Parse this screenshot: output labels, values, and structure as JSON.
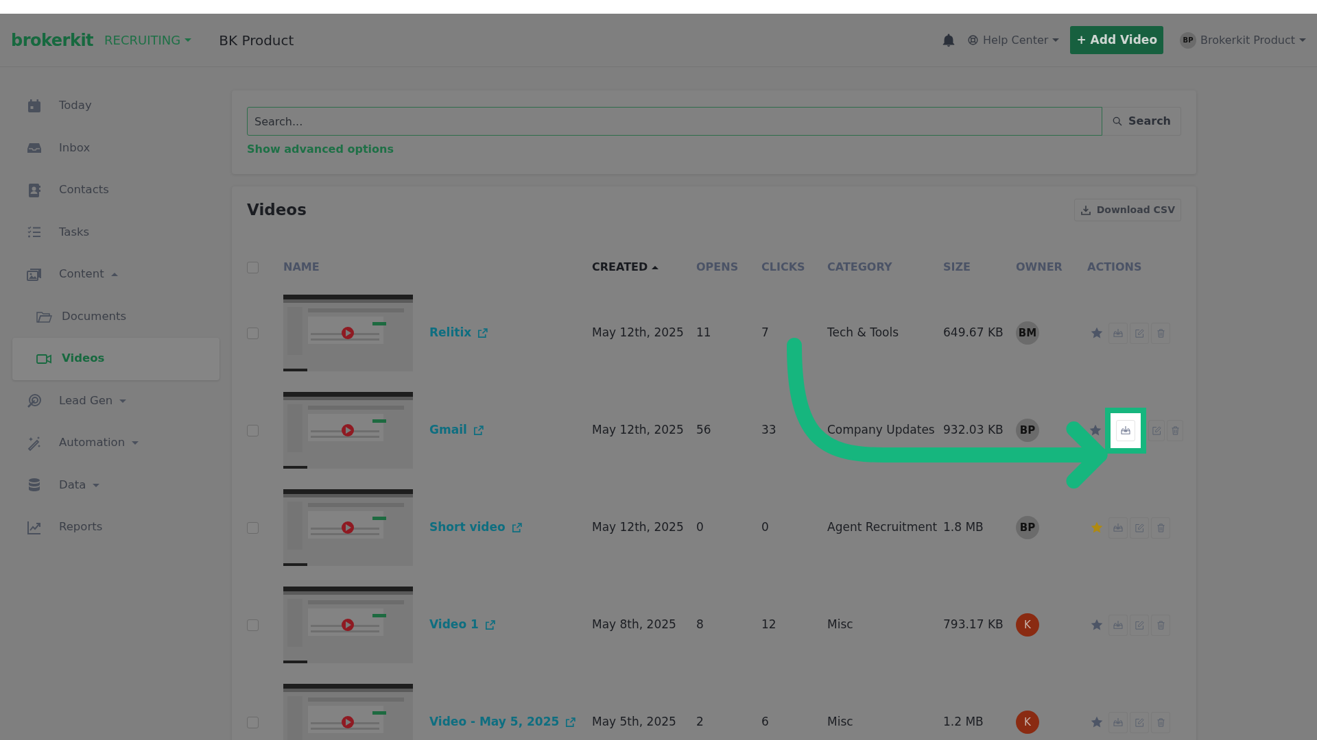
{
  "header": {
    "brand": "brokerkit",
    "module": "RECRUITING",
    "workspace": "BK Product",
    "help": "Help Center",
    "add_button": "+ Add Video",
    "user": {
      "initials": "BP",
      "name": "Brokerkit Product"
    }
  },
  "sidebar": {
    "items": [
      {
        "label": "Today",
        "selected": false
      },
      {
        "label": "Inbox",
        "selected": false
      },
      {
        "label": "Contacts",
        "selected": false
      },
      {
        "label": "Tasks",
        "selected": false
      },
      {
        "label": "Content",
        "selected": false,
        "expanded": true,
        "children": [
          {
            "label": "Documents",
            "selected": false
          },
          {
            "label": "Videos",
            "selected": true
          }
        ]
      },
      {
        "label": "Lead Gen",
        "selected": false,
        "expanded": false
      },
      {
        "label": "Automation",
        "selected": false,
        "expanded": false
      },
      {
        "label": "Data",
        "selected": false,
        "expanded": false
      },
      {
        "label": "Reports",
        "selected": false
      }
    ]
  },
  "search": {
    "placeholder": "Search...",
    "button": "Search",
    "advanced_link": "Show advanced options"
  },
  "videos": {
    "title": "Videos",
    "download_button": "Download CSV",
    "all_selected": false,
    "columns": [
      {
        "label": "NAME",
        "sorted": false
      },
      {
        "label": "CREATED",
        "sorted": true
      },
      {
        "label": "OPENS",
        "sorted": false
      },
      {
        "label": "CLICKS",
        "sorted": false
      },
      {
        "label": "CATEGORY",
        "sorted": false
      },
      {
        "label": "SIZE",
        "sorted": false
      },
      {
        "label": "OWNER",
        "sorted": false
      },
      {
        "label": "ACTIONS",
        "sorted": false
      }
    ],
    "rows": [
      {
        "checked": false,
        "name": "Relitix",
        "created": "May 12th, 2025",
        "opens": "11",
        "clicks": "7",
        "category": "Tech & Tools",
        "size": "649.67 KB",
        "owner": {
          "initials": "BM",
          "color": "#6b6b6b"
        },
        "starred": false,
        "highlighted": false
      },
      {
        "checked": false,
        "name": "Gmail",
        "created": "May 12th, 2025",
        "opens": "56",
        "clicks": "33",
        "category": "Company Updates",
        "size": "932.03 KB",
        "owner": {
          "initials": "BP",
          "color": "#6b6b6b"
        },
        "starred": false,
        "highlighted": true
      },
      {
        "checked": false,
        "name": "Short video",
        "created": "May 12th, 2025",
        "opens": "0",
        "clicks": "0",
        "category": "Agent Recruitment",
        "size": "1.8 MB",
        "owner": {
          "initials": "BP",
          "color": "#6b6b6b"
        },
        "starred": true,
        "highlighted": false
      },
      {
        "checked": false,
        "name": "Video 1",
        "created": "May 8th, 2025",
        "opens": "8",
        "clicks": "12",
        "category": "Misc",
        "size": "793.17 KB",
        "owner": {
          "initials": "K",
          "color": "#8a2b12"
        },
        "starred": false,
        "highlighted": false
      },
      {
        "checked": false,
        "name": "Video - May 5, 2025",
        "created": "May 5th, 2025",
        "opens": "2",
        "clicks": "6",
        "category": "Misc",
        "size": "1.2 MB",
        "owner": {
          "initials": "K",
          "color": "#8a2b12"
        },
        "starred": false,
        "highlighted": false
      }
    ]
  }
}
